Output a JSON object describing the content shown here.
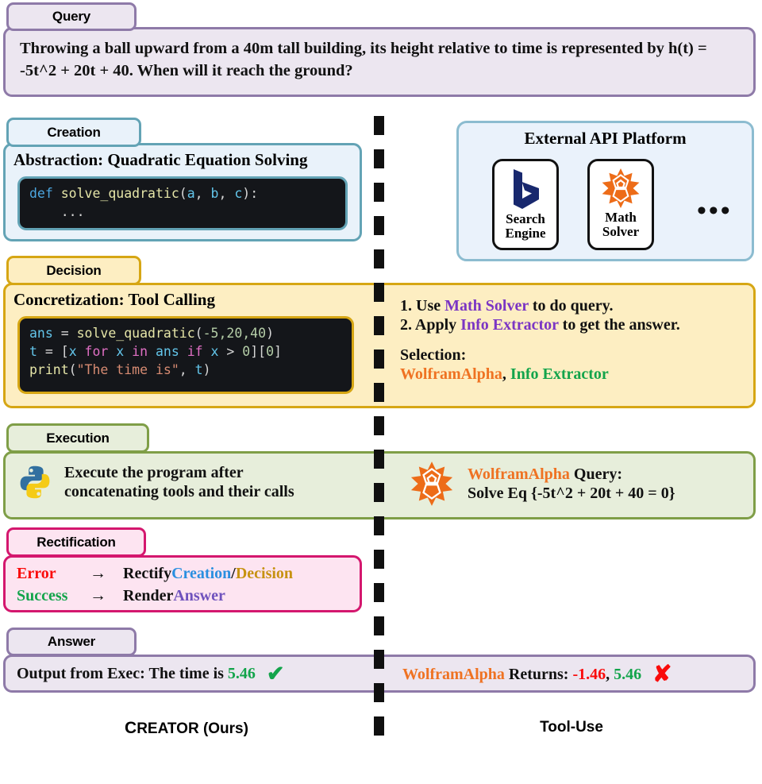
{
  "stages": {
    "query": {
      "tab": "Query",
      "accent": "#8e7aa8",
      "fill": "#ece6f0"
    },
    "creation": {
      "tab": "Creation",
      "accent": "#63a3b5",
      "fill": "#e9f2fa"
    },
    "decision": {
      "tab": "Decision",
      "accent": "#d6a614",
      "fill": "#fdeec2"
    },
    "execution": {
      "tab": "Execution",
      "accent": "#7f9e47",
      "fill": "#e7eedb"
    },
    "rectification": {
      "tab": "Rectification",
      "accent": "#d4176e",
      "fill": "#fde4f1"
    },
    "answer": {
      "tab": "Answer",
      "accent": "#8e7aa8",
      "fill": "#ece6f0"
    }
  },
  "query": {
    "text": "Throwing a ball upward from a 40m tall building, its height relative to time is represented by h(t) = -5t^2 + 20t + 40. When will it reach the ground?"
  },
  "creation": {
    "heading": "Abstraction: Quadratic Equation Solving",
    "code": {
      "line1_kw": "def",
      "line1_fn": "solve_quadratic",
      "line1_open": "(",
      "line1_a": "a",
      "line1_sep1": ", ",
      "line1_b": "b",
      "line1_sep2": ", ",
      "line1_c": "c",
      "line1_close": "):",
      "line2": "    ..."
    }
  },
  "api_platform": {
    "title": "External API Platform",
    "tools": [
      {
        "label": "Search\nEngine",
        "icon": "bing-logo-icon"
      },
      {
        "label": "Math\nSolver",
        "icon": "wolframalpha-logo-icon"
      }
    ],
    "ellipsis": "•••"
  },
  "decision": {
    "heading": "Concretization: Tool Calling",
    "code": {
      "l1_var": "ans",
      "l1_eq": " = ",
      "l1_fn": "solve_quadratic",
      "l1_open": "(",
      "l1_args": "-5,20,40",
      "l1_close": ")",
      "l2_t": "t",
      "l2_eq": " = [",
      "l2_x1": "x",
      "l2_for": " for ",
      "l2_x2": "x",
      "l2_in": " in ",
      "l2_ans": "ans",
      "l2_if": " if ",
      "l2_x3": "x",
      "l2_gt": " > ",
      "l2_zero": "0",
      "l2_tail": "][",
      "l2_zero2": "0",
      "l2_tail2": "]",
      "l3_fn": "print",
      "l3_open": "(",
      "l3_str": "\"The time is\"",
      "l3_comma": ", ",
      "l3_t": "t",
      "l3_close": ")"
    },
    "steps": [
      {
        "num": "1. Use ",
        "tool": "Math Solver",
        "tail": " to do query."
      },
      {
        "num": "2. Apply ",
        "tool": "Info Extractor",
        "tail": " to get the answer."
      }
    ],
    "selection_label": "Selection:",
    "selection_tool_1": "WolframAlpha",
    "selection_comma": ", ",
    "selection_tool_2": "Info Extractor"
  },
  "execution": {
    "left_icon": "python-logo-icon",
    "left_line1": "Execute the program after",
    "left_line2": "concatenating tools and their calls",
    "right_icon": "wolframalpha-logo-icon",
    "right_tool": "WolframAlpha",
    "right_tail": " Query:",
    "right_line2": "Solve Eq {-5t^2 + 20t + 40 = 0}"
  },
  "rectification": {
    "row1_status": "Error",
    "row1_arrow": "→",
    "row1_action": "Rectify ",
    "row1_target_a": "Creation",
    "row1_slash": " / ",
    "row1_target_b": "Decision",
    "row2_status": "Success",
    "row2_arrow": "→",
    "row2_action": "Render ",
    "row2_target": "Answer"
  },
  "answer": {
    "left_prefix": "Output from Exec: The time is ",
    "left_value": "5.46",
    "left_mark": "✔",
    "right_tool": "WolframAlpha",
    "right_mid": " Returns: ",
    "right_value_bad": "-1.46",
    "right_comma": ", ",
    "right_value_good": "5.46",
    "right_mark": "✘"
  },
  "footer": {
    "left_lead": "C",
    "left_rest": "REATOR (Ours)",
    "right": "Tool-Use"
  },
  "colors": {
    "purple": "#7b35c4",
    "orange": "#ef7222",
    "green": "#13a44b",
    "red": "#fa0b0b",
    "blue": "#2a8fe0",
    "gold": "#c79211",
    "violet": "#6f52bd"
  }
}
